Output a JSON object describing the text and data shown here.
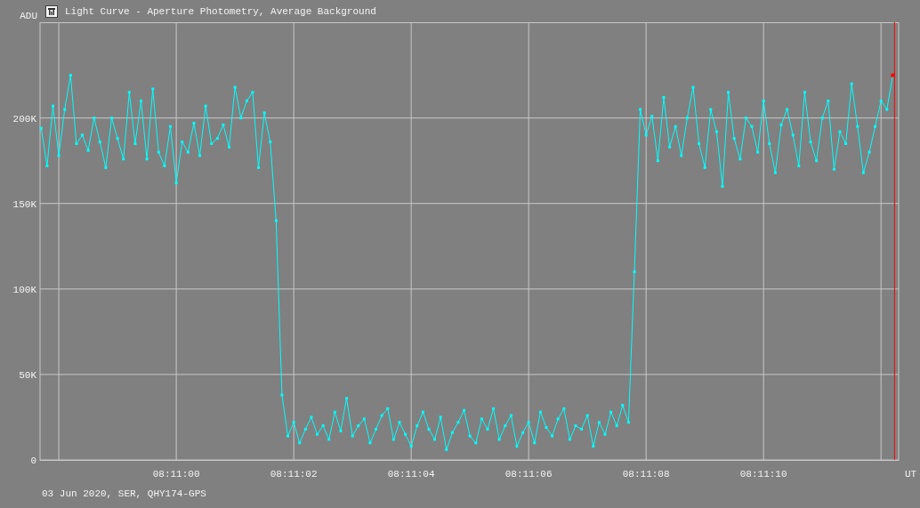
{
  "window": {
    "title": "Light Curve - Aperture Photometry, Average Background"
  },
  "chart": {
    "chart_data": {
      "type": "line",
      "ylabel": "ADU",
      "xlabel": "UT",
      "grid": true,
      "ylim": [
        0,
        256
      ],
      "yticks": [
        {
          "value": 0,
          "label": "0"
        },
        {
          "value": 50,
          "label": "50K"
        },
        {
          "value": 100,
          "label": "100K"
        },
        {
          "value": 150,
          "label": "150K"
        },
        {
          "value": 200,
          "label": "200K"
        }
      ],
      "categories": [
        null,
        null,
        null,
        null,
        null,
        null,
        null,
        null,
        null,
        null,
        null,
        null,
        null,
        null,
        null,
        null,
        null,
        null,
        null,
        null,
        null,
        null,
        null,
        "08:11:00",
        null,
        null,
        null,
        null,
        null,
        null,
        null,
        null,
        null,
        null,
        null,
        null,
        null,
        null,
        null,
        null,
        null,
        null,
        null,
        "08:11:02",
        null,
        null,
        null,
        null,
        null,
        null,
        null,
        null,
        null,
        null,
        null,
        null,
        null,
        null,
        null,
        null,
        null,
        null,
        null,
        "08:11:04",
        null,
        null,
        null,
        null,
        null,
        null,
        null,
        null,
        null,
        null,
        null,
        null,
        null,
        null,
        null,
        null,
        null,
        null,
        null,
        "08:11:06",
        null,
        null,
        null,
        null,
        null,
        null,
        null,
        null,
        null,
        null,
        null,
        null,
        null,
        null,
        null,
        null,
        null,
        null,
        null,
        "08:11:08",
        null,
        null,
        null,
        null,
        null,
        null,
        null,
        null,
        null,
        null,
        null,
        null,
        null,
        null,
        null,
        null,
        null,
        null,
        null,
        "08:11:10",
        null,
        null,
        null,
        null,
        null,
        null,
        null,
        null,
        null,
        null,
        null,
        null,
        null,
        null,
        null,
        null,
        null,
        null,
        null,
        null,
        null,
        null
      ],
      "series": [
        {
          "color": "#00ffff",
          "marker": "square",
          "values": [
            194,
            172,
            207,
            178,
            205,
            225,
            185,
            190,
            181,
            200,
            186,
            171,
            200,
            188,
            176,
            215,
            185,
            210,
            176,
            217,
            180,
            172,
            195,
            162,
            186,
            180,
            197,
            178,
            207,
            185,
            188,
            196,
            183,
            218,
            200,
            210,
            215,
            171,
            203,
            186,
            140,
            38,
            14,
            22,
            10,
            18,
            25,
            15,
            20,
            12,
            28,
            17,
            36,
            14,
            20,
            24,
            10,
            18,
            26,
            30,
            12,
            22,
            15,
            8,
            20,
            28,
            18,
            12,
            25,
            6,
            16,
            22,
            29,
            14,
            10,
            24,
            18,
            30,
            12,
            20,
            26,
            8,
            16,
            22,
            10,
            28,
            19,
            14,
            24,
            30,
            12,
            20,
            18,
            26,
            8,
            22,
            15,
            28,
            20,
            32,
            22,
            110,
            205,
            190,
            201,
            175,
            212,
            183,
            195,
            178,
            200,
            218,
            185,
            171,
            205,
            192,
            160,
            215,
            188,
            176,
            200,
            195,
            180,
            210,
            185,
            168,
            196,
            205,
            190,
            172,
            215,
            186,
            175,
            200,
            210,
            170,
            192,
            185,
            220,
            195,
            168,
            180,
            195,
            210,
            205,
            225
          ]
        }
      ]
    }
  },
  "status_bar": {
    "text": "03 Jun 2020, SER, QHY174-GPS"
  }
}
